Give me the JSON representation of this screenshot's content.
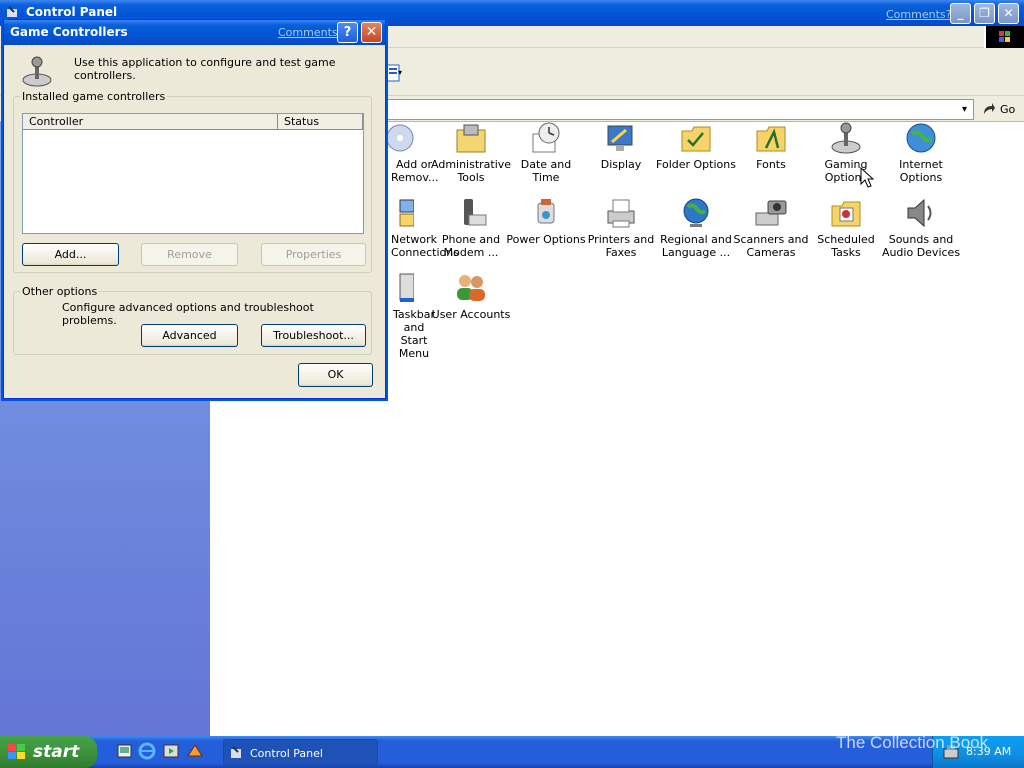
{
  "control_panel": {
    "title": "Control Panel",
    "comments_link": "Comments?",
    "go_label": "Go",
    "icons": [
      {
        "label_1": "Add or",
        "label_2": "Remov..."
      },
      {
        "label_1": "Administrative",
        "label_2": "Tools"
      },
      {
        "label_1": "Date and Time",
        "label_2": ""
      },
      {
        "label_1": "Display",
        "label_2": ""
      },
      {
        "label_1": "Folder Options",
        "label_2": ""
      },
      {
        "label_1": "Fonts",
        "label_2": ""
      },
      {
        "label_1": "Gaming",
        "label_2": "Options"
      },
      {
        "label_1": "Internet",
        "label_2": "Options"
      },
      {
        "label_1": "Network",
        "label_2": "Connections"
      },
      {
        "label_1": "Phone and",
        "label_2": "Modem ..."
      },
      {
        "label_1": "Power Options",
        "label_2": ""
      },
      {
        "label_1": "Printers and",
        "label_2": "Faxes"
      },
      {
        "label_1": "Regional and",
        "label_2": "Language ..."
      },
      {
        "label_1": "Scanners and",
        "label_2": "Cameras"
      },
      {
        "label_1": "Scheduled",
        "label_2": "Tasks"
      },
      {
        "label_1": "Sounds and",
        "label_2": "Audio Devices"
      },
      {
        "label_1": "Taskbar and",
        "label_2": "Start Menu"
      },
      {
        "label_1": "User Accounts",
        "label_2": ""
      }
    ]
  },
  "dialog": {
    "title": "Game Controllers",
    "comments_link": "Comments?",
    "help_glyph": "?",
    "close_glyph": "✕",
    "intro": "Use this application to configure and test game controllers.",
    "installed_group": "Installed game controllers",
    "columns": {
      "controller": "Controller",
      "status": "Status"
    },
    "add_label": "Add...",
    "remove_label": "Remove",
    "properties_label": "Properties",
    "other_group": "Other options",
    "other_text": "Configure advanced options and troubleshoot problems.",
    "advanced_label": "Advanced",
    "troubleshoot_label": "Troubleshoot...",
    "ok_label": "OK"
  },
  "taskbar": {
    "start_label": "start",
    "task_label": "Control Panel",
    "clock": "8:39 AM"
  },
  "watermark": "The Collection Book",
  "colors": {
    "titlebar": "#0055d5",
    "start_green": "#3c8f3a",
    "taskbar": "#245edb",
    "left_pane": "#6f8ade"
  }
}
